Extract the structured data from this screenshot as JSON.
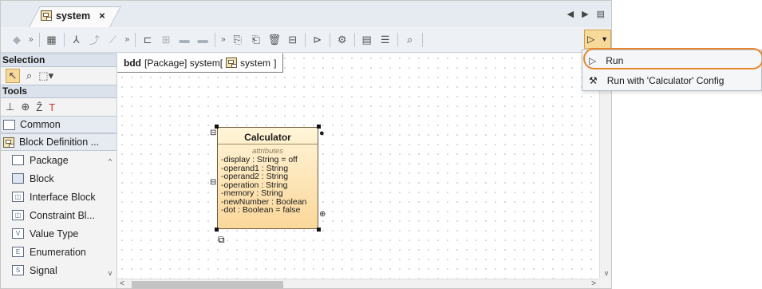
{
  "tab": {
    "title": "system",
    "close": "×"
  },
  "tab_controls": [
    "◀",
    "▶",
    "▤"
  ],
  "toolbar": {
    "run_icon": "play-icon"
  },
  "palette": {
    "selection_header": "Selection",
    "tools_header": "Tools",
    "common_group": "Common",
    "block_def_group": "Block Definition ...",
    "items": [
      {
        "label": "Package",
        "icon": "folder-icon"
      },
      {
        "label": "Block",
        "icon": "block-icon"
      },
      {
        "label": "Interface Block",
        "icon": "interface-block-icon"
      },
      {
        "label": "Constraint Bl...",
        "icon": "constraint-block-icon"
      },
      {
        "label": "Value Type",
        "icon": "value-type-icon"
      },
      {
        "label": "Enumeration",
        "icon": "enumeration-icon"
      },
      {
        "label": "Signal",
        "icon": "signal-icon"
      }
    ]
  },
  "diagram": {
    "frame_prefix": "bdd",
    "frame_text": "[Package] system[",
    "frame_name": "system",
    "frame_suffix": "]",
    "block": {
      "name": "Calculator",
      "section": "attributes",
      "attributes": [
        "-display : String = off",
        "-operand1 : String",
        "-operand2 : String",
        "-operation : String",
        "-memory : String",
        "-newNumber : Boolean",
        "-dot : Boolean = false"
      ]
    }
  },
  "menu": {
    "items": [
      {
        "label": "Run",
        "icon": "play-icon"
      },
      {
        "label": "Run with 'Calculator' Config",
        "icon": "tools-icon"
      }
    ]
  },
  "colors": {
    "highlight": "#e8862a",
    "block_fill": "#fbd79a",
    "selected_button": "#f7d99a"
  }
}
